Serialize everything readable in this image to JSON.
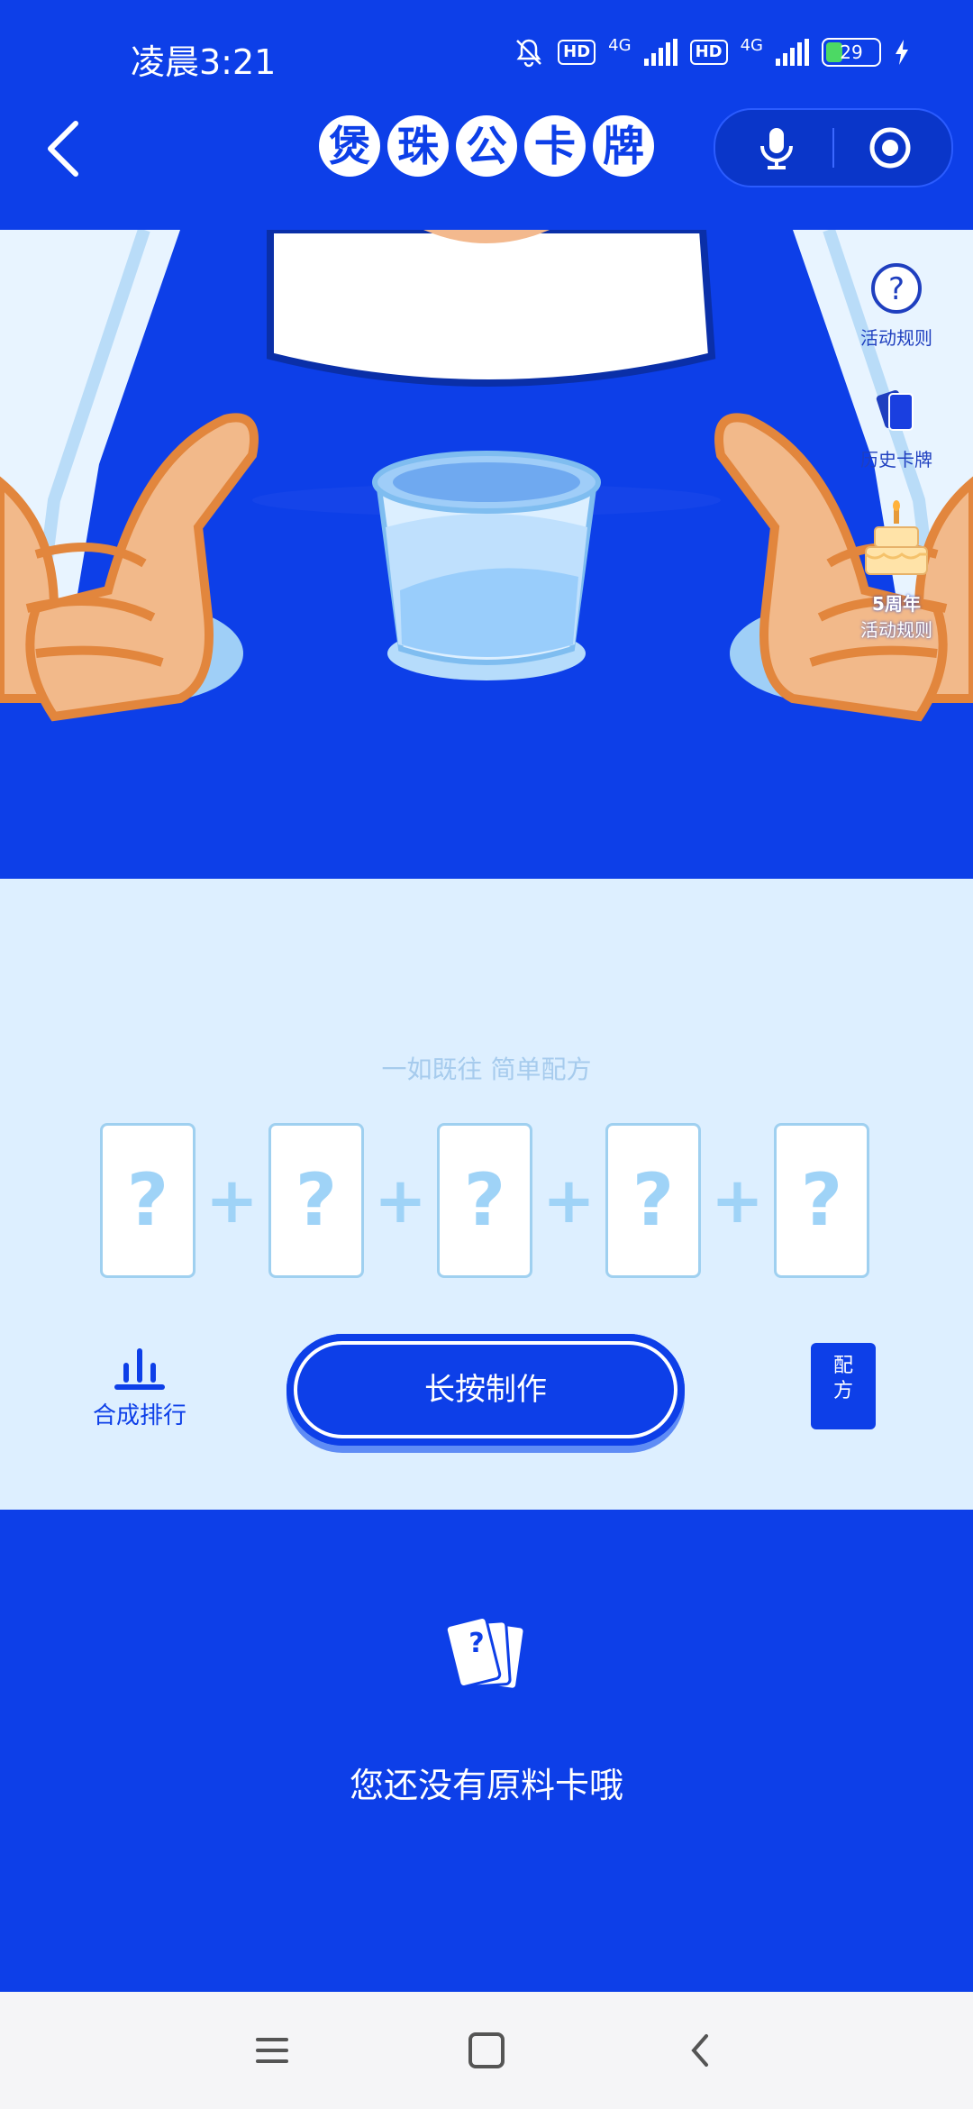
{
  "status_bar": {
    "time": "凌晨3:21",
    "hd1": "HD",
    "net1": "4G",
    "hd2": "HD",
    "net2": "4G",
    "battery": "29"
  },
  "header": {
    "title_chars": [
      "煲",
      "珠",
      "公",
      "卡",
      "牌"
    ]
  },
  "side": {
    "rules": "活动规则",
    "history": "历史卡牌",
    "anniv_line1": "5周年",
    "anniv_line2": "活动规则"
  },
  "recipe": {
    "slogan": "一如既往 简单配方",
    "card_mark": "?",
    "plus": "+"
  },
  "controls": {
    "rank": "合成排行",
    "make": "长按制作",
    "book_line1": "配",
    "book_line2": "方"
  },
  "empty": {
    "text": "您还没有原料卡哦",
    "card_mark": "?"
  },
  "colors": {
    "brand_blue": "#0d3fe8",
    "light_blue": "#ddefff",
    "card_border": "#9fd0f0"
  }
}
